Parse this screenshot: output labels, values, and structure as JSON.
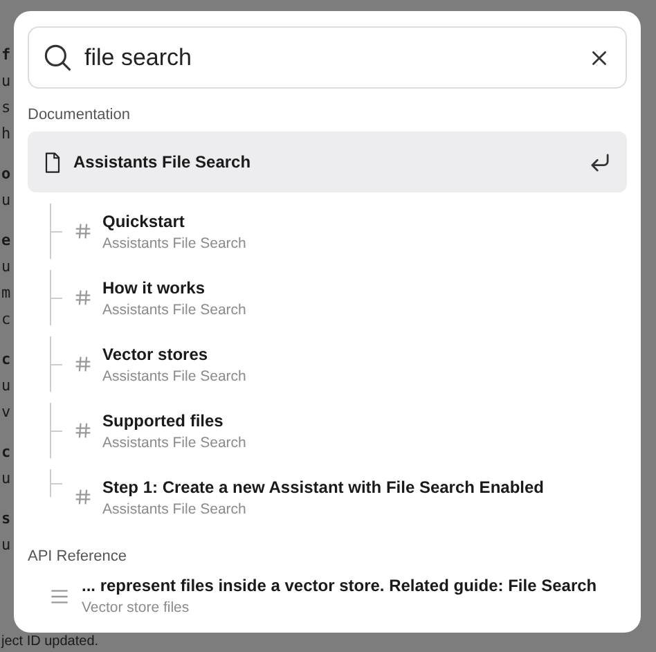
{
  "background": {
    "fragments": [
      {
        "text": "f",
        "kind": "heading"
      },
      {
        "text": "u",
        "kind": "text"
      },
      {
        "text": "s",
        "kind": "text"
      },
      {
        "text": "h",
        "kind": "text"
      },
      {
        "text": "o",
        "kind": "heading"
      },
      {
        "text": "u",
        "kind": "text"
      },
      {
        "text": "e",
        "kind": "heading"
      },
      {
        "text": "u",
        "kind": "text"
      },
      {
        "text": "m",
        "kind": "text"
      },
      {
        "text": "c",
        "kind": "text"
      },
      {
        "text": "c",
        "kind": "heading"
      },
      {
        "text": "u",
        "kind": "text"
      },
      {
        "text": "v",
        "kind": "text"
      },
      {
        "text": "c",
        "kind": "heading"
      },
      {
        "text": "u",
        "kind": "text"
      },
      {
        "text": "s",
        "kind": "heading"
      },
      {
        "text": "u",
        "kind": "text"
      }
    ],
    "footer": "ject ID updated."
  },
  "search": {
    "value": "file search"
  },
  "sections": [
    {
      "title": "Documentation",
      "results": [
        {
          "kind": "page",
          "title": "Assistants File Search",
          "selected": true,
          "children": [
            {
              "title": "Quickstart",
              "subtitle": "Assistants File Search",
              "selected": false
            },
            {
              "title": "How it works",
              "subtitle": "Assistants File Search",
              "selected": false
            },
            {
              "title": "Vector stores",
              "subtitle": "Assistants File Search",
              "selected": false
            },
            {
              "title": "Supported files",
              "subtitle": "Assistants File Search",
              "selected": false
            },
            {
              "title": "Step 1: Create a new Assistant with File Search Enabled",
              "subtitle": "Assistants File Search",
              "selected": false
            }
          ]
        }
      ]
    },
    {
      "title": "API Reference",
      "results": [
        {
          "kind": "reference",
          "title": "... represent files inside a vector store. Related guide: File Search",
          "subtitle": "Vector store files",
          "selected": false
        }
      ]
    }
  ]
}
